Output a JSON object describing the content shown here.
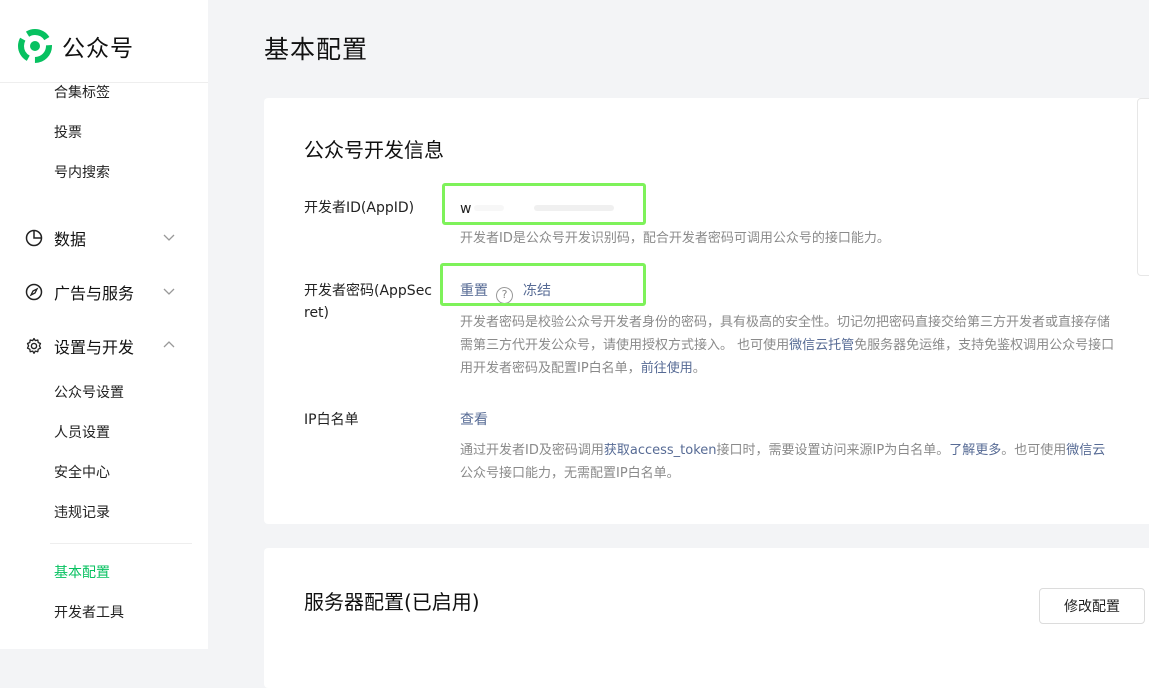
{
  "brand": {
    "name": "公众号",
    "accent": "#07c160",
    "highlight": "#7ef25a"
  },
  "sidebar": {
    "top_items": [
      "合集标签",
      "投票",
      "号内搜索"
    ],
    "groups": [
      {
        "label": "数据",
        "icon": "pie-chart-icon"
      },
      {
        "label": "广告与服务",
        "icon": "compass-icon"
      },
      {
        "label": "设置与开发",
        "icon": "gear-icon"
      }
    ],
    "settings_items": [
      "公众号设置",
      "人员设置",
      "安全中心",
      "违规记录"
    ],
    "dev_items": [
      "基本配置",
      "开发者工具"
    ],
    "active_item": "基本配置"
  },
  "page": {
    "title": "基本配置"
  },
  "dev_info": {
    "title": "公众号开发信息",
    "appid": {
      "label": "开发者ID(AppID)",
      "value": "w",
      "hint": "开发者ID是公众号开发识别码，配合开发者密码可调用公众号的接口能力。"
    },
    "secret": {
      "label_line1": "开发者密码(AppSec",
      "label_line2": "ret)",
      "reset": "重置",
      "help": "?",
      "freeze": "冻结",
      "hint_line1": "开发者密码是校验公众号开发者身份的密码，具有极高的安全性。切记勿把密码直接交给第三方开发者或直接存储",
      "hint_line2_a": "需第三方代开发公众号，请使用授权方式接入。 也可使用",
      "hint_line2_link": "微信云托管",
      "hint_line2_b": "免服务器免运维，支持免鉴权调用公众号接口",
      "hint_line3_a": "用开发者密码及配置IP白名单，",
      "hint_line3_link": "前往使用",
      "hint_line3_b": "。"
    },
    "ip": {
      "label": "IP白名单",
      "view": "查看",
      "hint_line1_a": "通过开发者ID及密码调用",
      "hint_line1_link1": "获取access_token",
      "hint_line1_b": "接口时，需要设置访问来源IP为白名单。",
      "hint_line1_link2": "了解更多",
      "hint_line1_c": "。也可使用",
      "hint_line1_link3": "微信云",
      "hint_line2": "公众号接口能力，无需配置IP白名单。"
    }
  },
  "server": {
    "title": "服务器配置(已启用)",
    "edit_button": "修改配置"
  }
}
